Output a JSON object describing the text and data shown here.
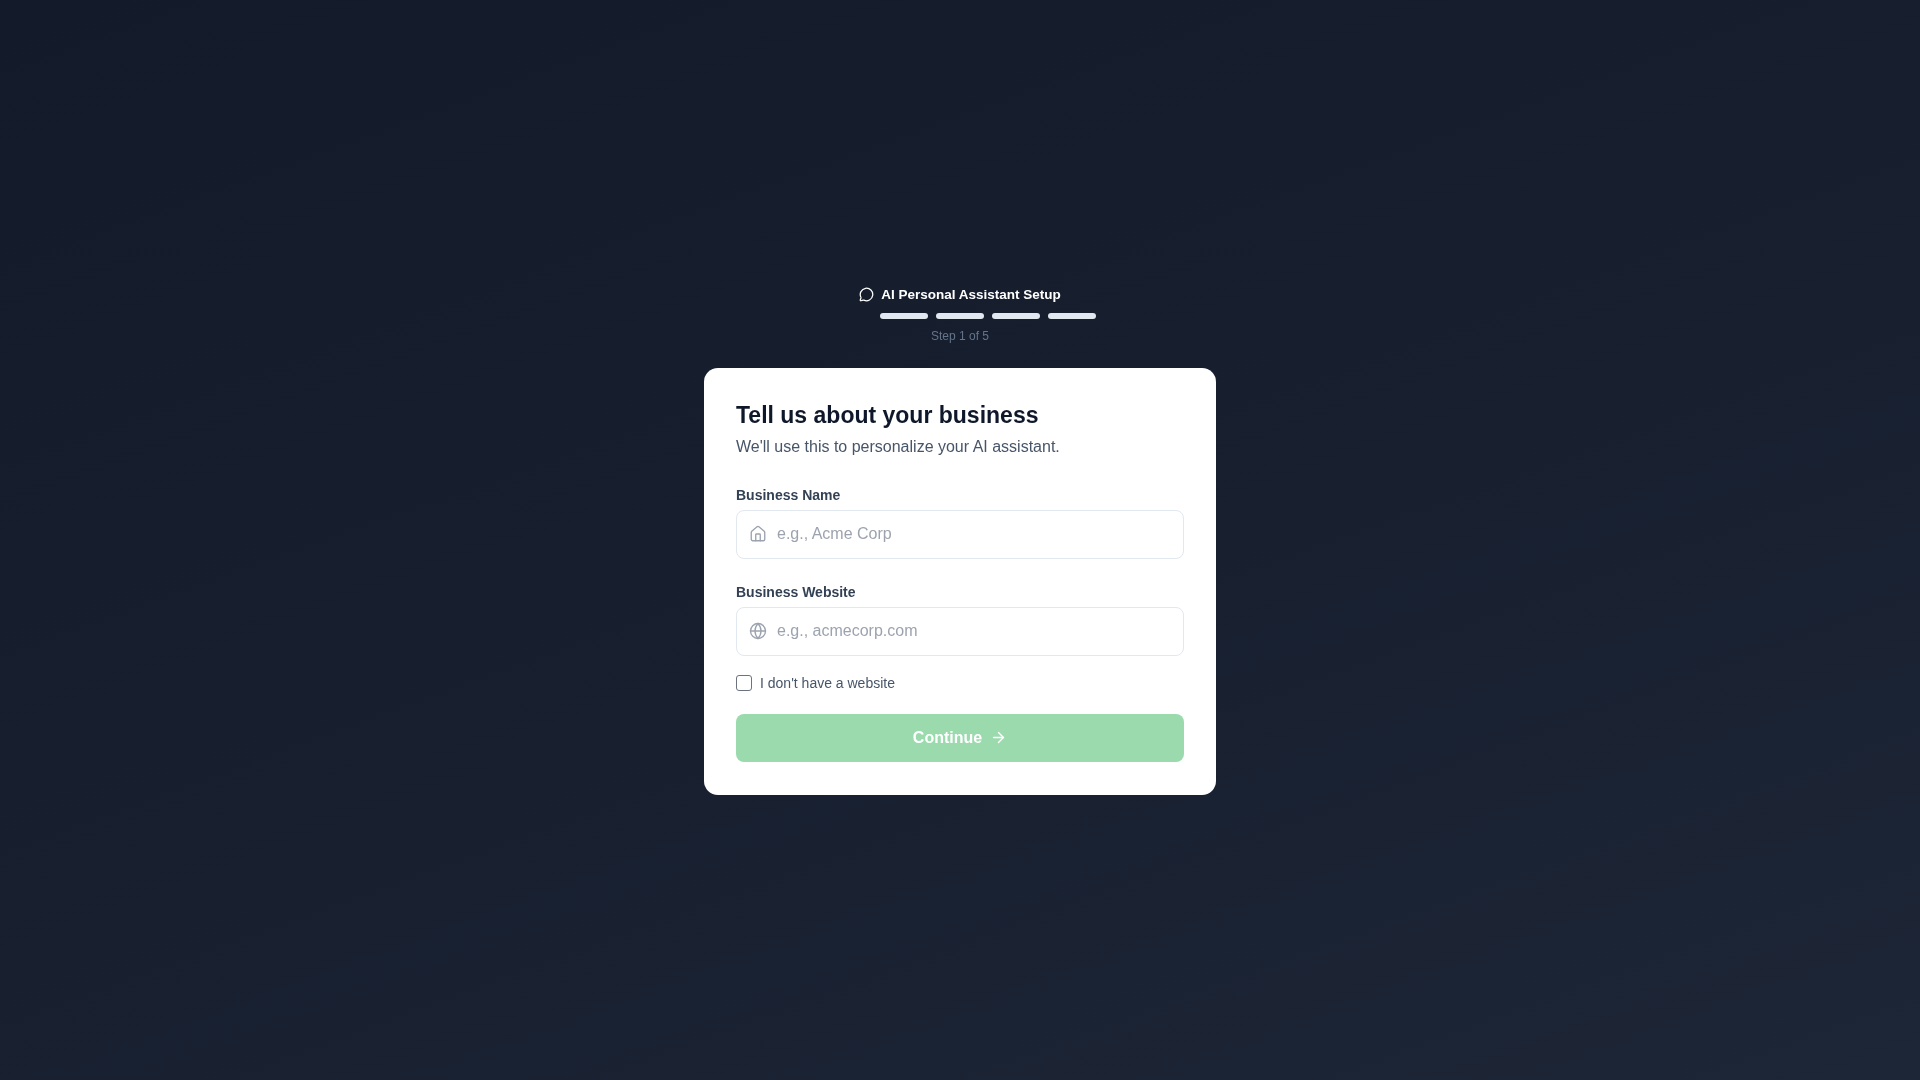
{
  "header": {
    "title": "AI Personal Assistant Setup",
    "progress": [
      {
        "filled": true
      },
      {
        "filled": true
      },
      {
        "filled": true
      },
      {
        "filled": true
      }
    ],
    "step_label": "Step 1 of 5"
  },
  "card": {
    "title": "Tell us about your business",
    "subtitle": "We'll use this to personalize your AI assistant.",
    "fields": [
      {
        "kind": "name",
        "label": "Business Name",
        "placeholder": "e.g., Acme Corp"
      },
      {
        "kind": "website",
        "label": "Business Website",
        "placeholder": "e.g., acmecorp.com"
      }
    ],
    "no_website": {
      "label": "I don't have a website",
      "checked": false
    },
    "continue_button": {
      "label": "Continue",
      "disabled": true
    }
  }
}
